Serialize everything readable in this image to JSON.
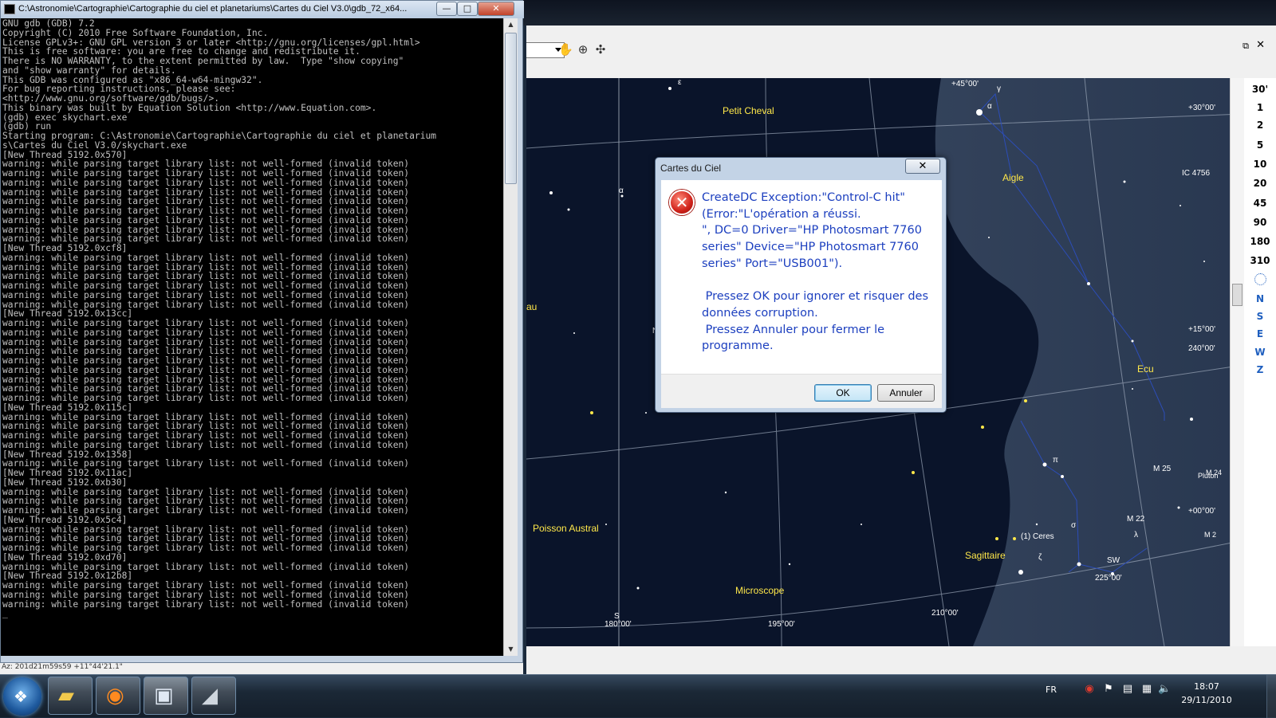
{
  "console": {
    "title": "C:\\Astronomie\\Cartographie\\Cartographie du ciel et planetariums\\Cartes du Ciel V3.0\\gdb_72_x64...",
    "minimize": "—",
    "maximize": "□",
    "close": "✕",
    "lines": [
      "GNU gdb (GDB) 7.2",
      "Copyright (C) 2010 Free Software Foundation, Inc.",
      "License GPLv3+: GNU GPL version 3 or later <http://gnu.org/licenses/gpl.html>",
      "This is free software: you are free to change and redistribute it.",
      "There is NO WARRANTY, to the extent permitted by law.  Type \"show copying\"",
      "and \"show warranty\" for details.",
      "This GDB was configured as \"x86_64-w64-mingw32\".",
      "For bug reporting instructions, please see:",
      "<http://www.gnu.org/software/gdb/bugs/>.",
      "This binary was built by Equation Solution <http://www.Equation.com>.",
      "(gdb) exec skychart.exe",
      "(gdb) run",
      "Starting program: C:\\Astronomie\\Cartographie\\Cartographie du ciel et planetarium",
      "s\\Cartes du Ciel V3.0/skychart.exe",
      "[New Thread 5192.0x570]",
      "warning: while parsing target library list: not well-formed (invalid token)",
      "warning: while parsing target library list: not well-formed (invalid token)",
      "warning: while parsing target library list: not well-formed (invalid token)",
      "warning: while parsing target library list: not well-formed (invalid token)",
      "warning: while parsing target library list: not well-formed (invalid token)",
      "warning: while parsing target library list: not well-formed (invalid token)",
      "warning: while parsing target library list: not well-formed (invalid token)",
      "warning: while parsing target library list: not well-formed (invalid token)",
      "warning: while parsing target library list: not well-formed (invalid token)",
      "[New Thread 5192.0xcf8]",
      "warning: while parsing target library list: not well-formed (invalid token)",
      "warning: while parsing target library list: not well-formed (invalid token)",
      "warning: while parsing target library list: not well-formed (invalid token)",
      "warning: while parsing target library list: not well-formed (invalid token)",
      "warning: while parsing target library list: not well-formed (invalid token)",
      "warning: while parsing target library list: not well-formed (invalid token)",
      "[New Thread 5192.0x13cc]",
      "warning: while parsing target library list: not well-formed (invalid token)",
      "warning: while parsing target library list: not well-formed (invalid token)",
      "warning: while parsing target library list: not well-formed (invalid token)",
      "warning: while parsing target library list: not well-formed (invalid token)",
      "warning: while parsing target library list: not well-formed (invalid token)",
      "warning: while parsing target library list: not well-formed (invalid token)",
      "warning: while parsing target library list: not well-formed (invalid token)",
      "warning: while parsing target library list: not well-formed (invalid token)",
      "warning: while parsing target library list: not well-formed (invalid token)",
      "[New Thread 5192.0x115c]",
      "warning: while parsing target library list: not well-formed (invalid token)",
      "warning: while parsing target library list: not well-formed (invalid token)",
      "warning: while parsing target library list: not well-formed (invalid token)",
      "warning: while parsing target library list: not well-formed (invalid token)",
      "[New Thread 5192.0x1358]",
      "warning: while parsing target library list: not well-formed (invalid token)",
      "[New Thread 5192.0x11ac]",
      "[New Thread 5192.0xb30]",
      "warning: while parsing target library list: not well-formed (invalid token)",
      "warning: while parsing target library list: not well-formed (invalid token)",
      "warning: while parsing target library list: not well-formed (invalid token)",
      "[New Thread 5192.0x5c4]",
      "warning: while parsing target library list: not well-formed (invalid token)",
      "warning: while parsing target library list: not well-formed (invalid token)",
      "warning: while parsing target library list: not well-formed (invalid token)",
      "[New Thread 5192.0xd70]",
      "warning: while parsing target library list: not well-formed (invalid token)",
      "[New Thread 5192.0x12b8]",
      "warning: while parsing target library list: not well-formed (invalid token)",
      "warning: while parsing target library list: not well-formed (invalid token)",
      "warning: while parsing target library list: not well-formed (invalid token)",
      "_"
    ]
  },
  "dialog": {
    "title": "Cartes du Ciel",
    "close": "✕",
    "message": "CreateDC Exception:\"Control-C hit\"\n(Error:\"L'opération a réussi.\n\", DC=0 Driver=\"HP Photosmart 7760\nseries\" Device=\"HP Photosmart 7760\nseries\" Port=\"USB001\").\n\n Pressez OK pour ignorer et risquer des\ndonnées corruption.\n Pressez Annuler pour fermer le\nprogramme.",
    "ok": "OK",
    "cancel": "Annuler",
    "icon": "error-x-icon"
  },
  "skychart": {
    "zoom_levels": [
      "30'",
      "1",
      "2",
      "5",
      "10",
      "20",
      "45",
      "90",
      "180",
      "310"
    ],
    "directions": [
      "N",
      "S",
      "E",
      "W",
      "Z"
    ],
    "constellations": [
      "Petit Cheval",
      "Aigle",
      "Ecu",
      "Poisson Austral",
      "Sagittaire",
      "Microscope"
    ],
    "objects": [
      "IC 4756",
      "M 25",
      "M 22",
      "Pluton",
      "(1) Ceres",
      "M 24",
      "M 2"
    ],
    "stars_greek": [
      "ε",
      "γ",
      "α",
      "α",
      "π",
      "σ",
      "λ",
      "ζ"
    ],
    "fragments": [
      "au",
      "N",
      "S",
      "SW"
    ],
    "dec_labels": [
      "+45°00'",
      "+30°00'",
      "+15°00'",
      "+00°00'"
    ],
    "ra_labels": [
      "180°00'",
      "195°00'",
      "210°00'",
      "225°00'",
      "240°00'"
    ],
    "status": "Az: 201d21m59s59 +11°44'21.1\""
  },
  "taskbar": {
    "lang": "FR",
    "time": "18:07",
    "date": "29/11/2010",
    "apps": [
      "folder-icon",
      "firefox-icon",
      "console-icon",
      "skychart-icon"
    ]
  },
  "colors": {
    "sky": "#0a142a",
    "label_yellow": "#ffe84a",
    "dialog_text": "#1c3fbf",
    "console_text": "#c0c0c0"
  }
}
